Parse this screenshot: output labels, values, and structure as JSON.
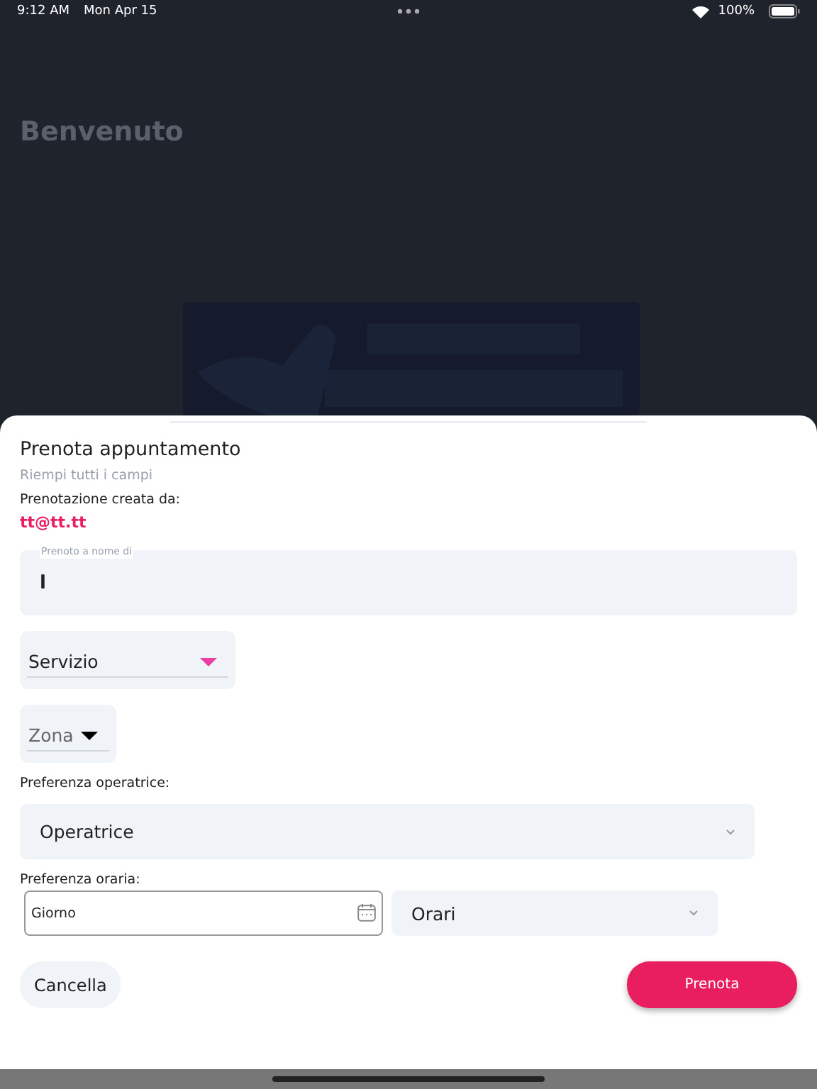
{
  "status_bar": {
    "time": "9:12 AM",
    "date": "Mon Apr 15",
    "battery": "100%"
  },
  "background": {
    "heading": "Benvenuto"
  },
  "sheet": {
    "title": "Prenota appuntamento",
    "subtitle": "Riempi tutti i campi",
    "created_by_label": "Prenotazione creata da:",
    "created_by": "tt@tt.tt",
    "name_field": {
      "label": "Prenoto a nome di",
      "value": "l"
    },
    "service_select": {
      "value": "Servizio"
    },
    "zone_select": {
      "value": "Zona"
    },
    "operator_label": "Preferenza operatrice:",
    "operator_select": {
      "value": "Operatrice"
    },
    "time_label": "Preferenza oraria:",
    "day_field": {
      "placeholder": "Giorno"
    },
    "hours_select": {
      "value": "Orari"
    },
    "cancel_button": "Cancella",
    "submit_button": "Prenota"
  }
}
